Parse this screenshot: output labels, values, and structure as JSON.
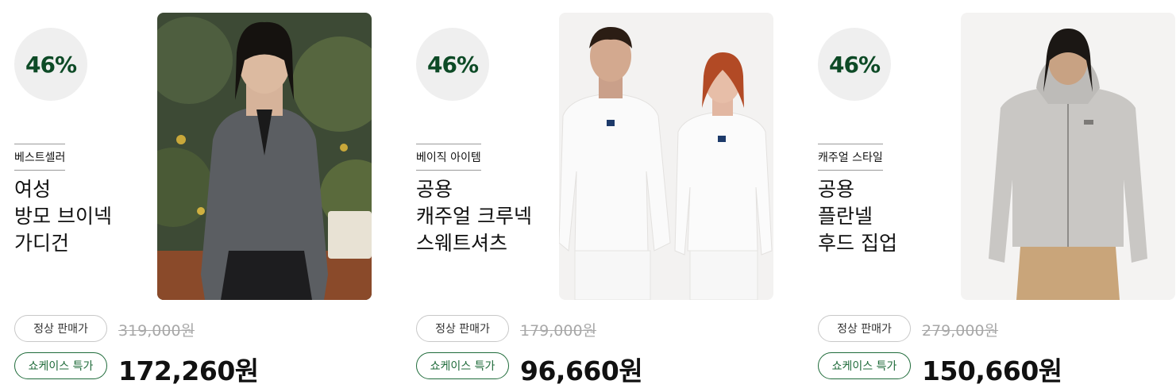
{
  "products": [
    {
      "discount": "46%",
      "tag": "베스트셀러",
      "title_lines": [
        "여성",
        "방모 브이넥",
        "가디건"
      ],
      "regular_label": "정상 판매가",
      "original_price": "319,000원",
      "sale_label": "쇼케이스 특가",
      "sale_price": "172,260원",
      "image": "woman-gray-cardigan-photo"
    },
    {
      "discount": "46%",
      "tag": "베이직 아이템",
      "title_lines": [
        "공용",
        "캐주얼 크루넥",
        "스웨트셔츠"
      ],
      "regular_label": "정상 판매가",
      "original_price": "179,000원",
      "sale_label": "쇼케이스 특가",
      "sale_price": "96,660원",
      "image": "two-models-white-sweatshirt-photo"
    },
    {
      "discount": "46%",
      "tag": "캐주얼 스타일",
      "title_lines": [
        "공용",
        "플란넬",
        "후드 집업"
      ],
      "regular_label": "정상 판매가",
      "original_price": "279,000원",
      "sale_label": "쇼케이스 특가",
      "sale_price": "150,660원",
      "image": "man-gray-hood-zipup-photo"
    }
  ],
  "colors": {
    "discount_text": "#0d4a26",
    "badge_bg": "#efefef",
    "sale_accent": "#1f6b3a",
    "strike_text": "#a8a8a8"
  }
}
